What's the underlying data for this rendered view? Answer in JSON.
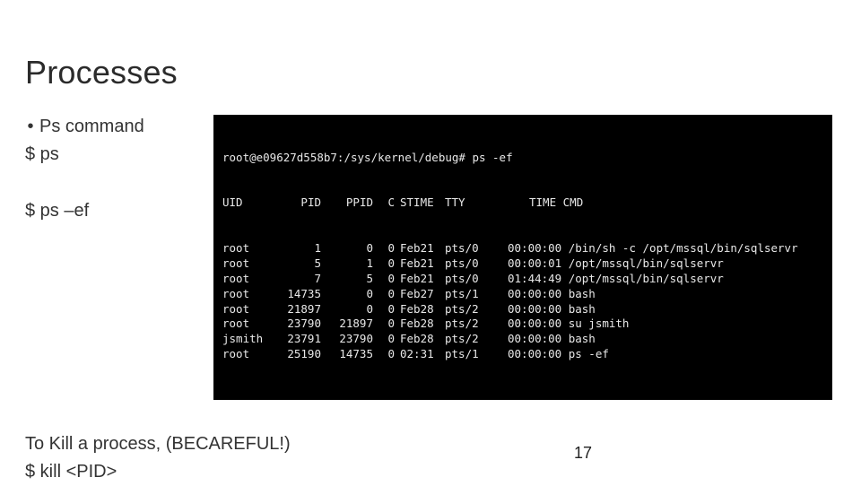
{
  "title": "Processes",
  "left": {
    "bullet": "Ps command",
    "ps": "$ ps",
    "psef": "$ ps –ef"
  },
  "terminal": {
    "prompt": "root@e09627d558b7:/sys/kernel/debug# ps -ef",
    "header": {
      "uid": "UID",
      "pid": "PID",
      "ppid": "PPID",
      "c": "C",
      "stime": "STIME",
      "tty": "TTY",
      "time": "TIME",
      "cmd": "CMD"
    },
    "rows": [
      {
        "uid": "root",
        "pid": "1",
        "ppid": "0",
        "c": "0",
        "stime": "Feb21",
        "tty": "pts/0",
        "time": "00:00:00",
        "cmd": "/bin/sh -c /opt/mssql/bin/sqlservr"
      },
      {
        "uid": "root",
        "pid": "5",
        "ppid": "1",
        "c": "0",
        "stime": "Feb21",
        "tty": "pts/0",
        "time": "00:00:01",
        "cmd": "/opt/mssql/bin/sqlservr"
      },
      {
        "uid": "root",
        "pid": "7",
        "ppid": "5",
        "c": "0",
        "stime": "Feb21",
        "tty": "pts/0",
        "time": "01:44:49",
        "cmd": "/opt/mssql/bin/sqlservr"
      },
      {
        "uid": "root",
        "pid": "14735",
        "ppid": "0",
        "c": "0",
        "stime": "Feb27",
        "tty": "pts/1",
        "time": "00:00:00",
        "cmd": "bash"
      },
      {
        "uid": "root",
        "pid": "21897",
        "ppid": "0",
        "c": "0",
        "stime": "Feb28",
        "tty": "pts/2",
        "time": "00:00:00",
        "cmd": "bash"
      },
      {
        "uid": "root",
        "pid": "23790",
        "ppid": "21897",
        "c": "0",
        "stime": "Feb28",
        "tty": "pts/2",
        "time": "00:00:00",
        "cmd": "su jsmith"
      },
      {
        "uid": "jsmith",
        "pid": "23791",
        "ppid": "23790",
        "c": "0",
        "stime": "Feb28",
        "tty": "pts/2",
        "time": "00:00:00",
        "cmd": "bash"
      },
      {
        "uid": "root",
        "pid": "25190",
        "ppid": "14735",
        "c": "0",
        "stime": "02:31",
        "tty": "pts/1",
        "time": "00:00:00",
        "cmd": "ps -ef"
      }
    ]
  },
  "kill": {
    "line1": "To Kill a process, (BECAREFUL!)",
    "line2": "$ kill <PID>"
  },
  "page_number": "17"
}
